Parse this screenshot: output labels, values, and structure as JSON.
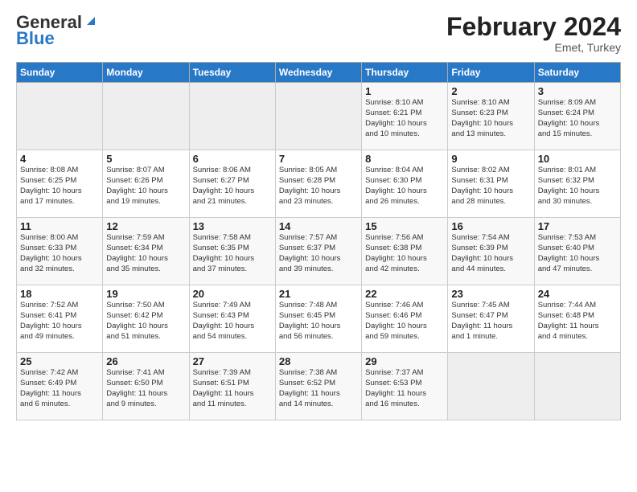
{
  "header": {
    "logo_line1": "General",
    "logo_line2": "Blue",
    "month": "February 2024",
    "location": "Emet, Turkey"
  },
  "days_of_week": [
    "Sunday",
    "Monday",
    "Tuesday",
    "Wednesday",
    "Thursday",
    "Friday",
    "Saturday"
  ],
  "weeks": [
    [
      {
        "day": "",
        "info": ""
      },
      {
        "day": "",
        "info": ""
      },
      {
        "day": "",
        "info": ""
      },
      {
        "day": "",
        "info": ""
      },
      {
        "day": "1",
        "info": "Sunrise: 8:10 AM\nSunset: 6:21 PM\nDaylight: 10 hours\nand 10 minutes."
      },
      {
        "day": "2",
        "info": "Sunrise: 8:10 AM\nSunset: 6:23 PM\nDaylight: 10 hours\nand 13 minutes."
      },
      {
        "day": "3",
        "info": "Sunrise: 8:09 AM\nSunset: 6:24 PM\nDaylight: 10 hours\nand 15 minutes."
      }
    ],
    [
      {
        "day": "4",
        "info": "Sunrise: 8:08 AM\nSunset: 6:25 PM\nDaylight: 10 hours\nand 17 minutes."
      },
      {
        "day": "5",
        "info": "Sunrise: 8:07 AM\nSunset: 6:26 PM\nDaylight: 10 hours\nand 19 minutes."
      },
      {
        "day": "6",
        "info": "Sunrise: 8:06 AM\nSunset: 6:27 PM\nDaylight: 10 hours\nand 21 minutes."
      },
      {
        "day": "7",
        "info": "Sunrise: 8:05 AM\nSunset: 6:28 PM\nDaylight: 10 hours\nand 23 minutes."
      },
      {
        "day": "8",
        "info": "Sunrise: 8:04 AM\nSunset: 6:30 PM\nDaylight: 10 hours\nand 26 minutes."
      },
      {
        "day": "9",
        "info": "Sunrise: 8:02 AM\nSunset: 6:31 PM\nDaylight: 10 hours\nand 28 minutes."
      },
      {
        "day": "10",
        "info": "Sunrise: 8:01 AM\nSunset: 6:32 PM\nDaylight: 10 hours\nand 30 minutes."
      }
    ],
    [
      {
        "day": "11",
        "info": "Sunrise: 8:00 AM\nSunset: 6:33 PM\nDaylight: 10 hours\nand 32 minutes."
      },
      {
        "day": "12",
        "info": "Sunrise: 7:59 AM\nSunset: 6:34 PM\nDaylight: 10 hours\nand 35 minutes."
      },
      {
        "day": "13",
        "info": "Sunrise: 7:58 AM\nSunset: 6:35 PM\nDaylight: 10 hours\nand 37 minutes."
      },
      {
        "day": "14",
        "info": "Sunrise: 7:57 AM\nSunset: 6:37 PM\nDaylight: 10 hours\nand 39 minutes."
      },
      {
        "day": "15",
        "info": "Sunrise: 7:56 AM\nSunset: 6:38 PM\nDaylight: 10 hours\nand 42 minutes."
      },
      {
        "day": "16",
        "info": "Sunrise: 7:54 AM\nSunset: 6:39 PM\nDaylight: 10 hours\nand 44 minutes."
      },
      {
        "day": "17",
        "info": "Sunrise: 7:53 AM\nSunset: 6:40 PM\nDaylight: 10 hours\nand 47 minutes."
      }
    ],
    [
      {
        "day": "18",
        "info": "Sunrise: 7:52 AM\nSunset: 6:41 PM\nDaylight: 10 hours\nand 49 minutes."
      },
      {
        "day": "19",
        "info": "Sunrise: 7:50 AM\nSunset: 6:42 PM\nDaylight: 10 hours\nand 51 minutes."
      },
      {
        "day": "20",
        "info": "Sunrise: 7:49 AM\nSunset: 6:43 PM\nDaylight: 10 hours\nand 54 minutes."
      },
      {
        "day": "21",
        "info": "Sunrise: 7:48 AM\nSunset: 6:45 PM\nDaylight: 10 hours\nand 56 minutes."
      },
      {
        "day": "22",
        "info": "Sunrise: 7:46 AM\nSunset: 6:46 PM\nDaylight: 10 hours\nand 59 minutes."
      },
      {
        "day": "23",
        "info": "Sunrise: 7:45 AM\nSunset: 6:47 PM\nDaylight: 11 hours\nand 1 minute."
      },
      {
        "day": "24",
        "info": "Sunrise: 7:44 AM\nSunset: 6:48 PM\nDaylight: 11 hours\nand 4 minutes."
      }
    ],
    [
      {
        "day": "25",
        "info": "Sunrise: 7:42 AM\nSunset: 6:49 PM\nDaylight: 11 hours\nand 6 minutes."
      },
      {
        "day": "26",
        "info": "Sunrise: 7:41 AM\nSunset: 6:50 PM\nDaylight: 11 hours\nand 9 minutes."
      },
      {
        "day": "27",
        "info": "Sunrise: 7:39 AM\nSunset: 6:51 PM\nDaylight: 11 hours\nand 11 minutes."
      },
      {
        "day": "28",
        "info": "Sunrise: 7:38 AM\nSunset: 6:52 PM\nDaylight: 11 hours\nand 14 minutes."
      },
      {
        "day": "29",
        "info": "Sunrise: 7:37 AM\nSunset: 6:53 PM\nDaylight: 11 hours\nand 16 minutes."
      },
      {
        "day": "",
        "info": ""
      },
      {
        "day": "",
        "info": ""
      }
    ]
  ]
}
